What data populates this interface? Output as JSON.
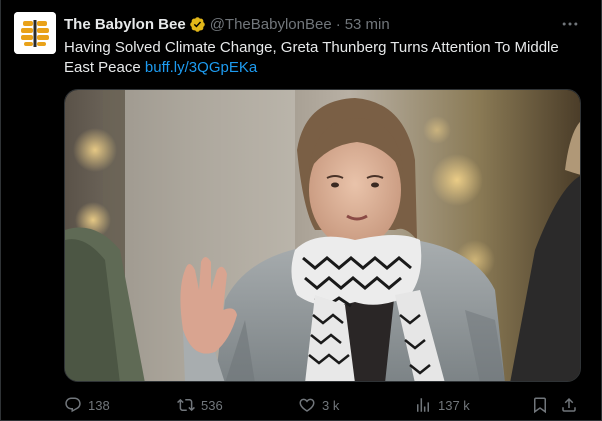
{
  "tweet": {
    "display_name": "The Babylon Bee",
    "handle": "@TheBabylonBee",
    "separator": "·",
    "time": "53 min",
    "text": "Having Solved Climate Change, Greta Thunberg Turns Attention To Middle East Peace",
    "link": "buff.ly/3QGpEKa"
  },
  "actions": {
    "replies": "138",
    "reposts": "536",
    "likes": "3 k",
    "views": "137 k"
  },
  "icons": {
    "verified": "gold-verified-badge-icon",
    "more": "more-horizontal-icon",
    "reply": "reply-icon",
    "repost": "repost-icon",
    "like": "heart-icon",
    "views": "analytics-icon",
    "bookmark": "bookmark-icon",
    "share": "share-icon"
  },
  "colors": {
    "background": "#000000",
    "text": "#e7e9ea",
    "muted": "#71767b",
    "link": "#1d9bf0",
    "verified_gold": "#e2b719",
    "border": "#2f3336"
  }
}
